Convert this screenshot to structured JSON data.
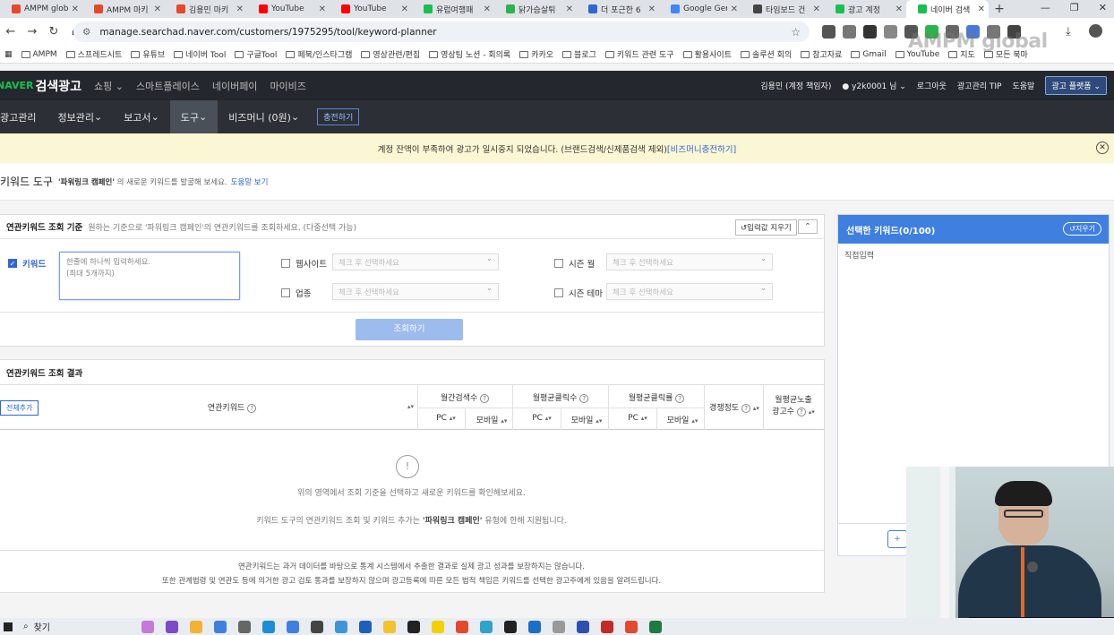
{
  "browser": {
    "tabs": [
      {
        "label": "AMPM glob",
        "color": "#e8472b"
      },
      {
        "label": "AMPM 마키",
        "color": "#e8472b"
      },
      {
        "label": "김용민 마키",
        "color": "#e8472b"
      },
      {
        "label": "YouTube",
        "color": "#ff0000"
      },
      {
        "label": "YouTube",
        "color": "#ff0000"
      },
      {
        "label": "유럽여행패",
        "color": "#17c04f"
      },
      {
        "label": "닭가슴살튀",
        "color": "#2ab54a"
      },
      {
        "label": "더 포근한 6",
        "color": "#2e67d1"
      },
      {
        "label": "Google Gen",
        "color": "#4285f4"
      },
      {
        "label": "타임보드 건",
        "color": "#444444"
      },
      {
        "label": "광고 계정",
        "color": "#17c04f"
      },
      {
        "label": "네이버 검색",
        "color": "#17c04f"
      }
    ],
    "active_tab_index": 11,
    "url": "manage.searchad.naver.com/customers/1975295/tool/keyword-planner",
    "bookmarks": [
      "AMPM",
      "스프레드시트",
      "유튜브",
      "네이버 Tool",
      "구글Tool",
      "페북/인스타그램",
      "영상관련/편집",
      "영상팀 노션 - 회의록",
      "카카오",
      "블로그",
      "키워드 관련 도구",
      "활용사이트",
      "솔루션 회의",
      "참고자료",
      "Gmail",
      "YouTube",
      "지도",
      "모든 북마"
    ]
  },
  "watermark": "AMPM global",
  "naver_header": {
    "logo": "NAVER",
    "service": "검색광고",
    "nav": [
      "쇼핑",
      "스마트플레이스",
      "네이버페이",
      "마이비즈"
    ],
    "user": "김용민 (계정 책임자)",
    "account": "y2k0001 님",
    "logout": "로그아웃",
    "tip": "광고관리 TIP",
    "help": "도움말",
    "platform_btn": "광고 플랫폼"
  },
  "menubar": {
    "items": [
      "광고관리",
      "정보관리",
      "보고서",
      "도구",
      "비즈머니 (0원)"
    ],
    "active_index": 3,
    "charge_btn": "충전하기"
  },
  "alert": {
    "text": "계정 잔액이 부족하여 광고가 일시중지 되었습니다. (브랜드검색/신제품검색 제외)",
    "link": "[비즈머니충전하기]"
  },
  "page": {
    "title": "키워드 도구",
    "desc_campaign": "'파워링크 캠페인'",
    "desc_rest": "의 새로운 키워드를 발굴해 보세요.",
    "help_link": "도움말 보기"
  },
  "search": {
    "title": "연관키워드 조회 기준",
    "subtitle": "원하는 기준으로 '파워링크 캠페인'의 연관키워드를 조회하세요. (다중선택 가능)",
    "reset_btn": "입력값 지우기",
    "keyword_label": "키워드",
    "keyword_placeholder_1": "한줄에 하나씩 입력하세요.",
    "keyword_placeholder_2": "(최대 5개까지)",
    "website_label": "웹사이트",
    "industry_label": "업종",
    "season_month_label": "시즌 월",
    "season_theme_label": "시즌 테마",
    "select_placeholder": "체크 후 선택하세요",
    "submit": "조회하기"
  },
  "results": {
    "title": "연관키워드 조회 결과",
    "add_all": "전체추가",
    "columns": {
      "keyword": "연관키워드",
      "monthly_search": "월간검색수",
      "avg_clicks": "월평균클릭수",
      "avg_ctr": "월평균클릭률",
      "competition": "경쟁정도",
      "avg_ads_1": "월평균노출",
      "avg_ads_2": "광고수",
      "pc": "PC",
      "mobile": "모바일"
    },
    "empty_msg": "위의 영역에서 조회 기준을 선택하고 새로운 키워드를 확인해보세요.",
    "empty_note_pre": "키워드 도구의 연관키워드 조회 및 키워드 추가는",
    "empty_note_bold": "'파워링크 캠페인'",
    "empty_note_post": "유형에 한해 지원됩니다.",
    "note1": "연관키워드는 과거 데이터를 바탕으로 통계 시스템에서 추출한 결과로 실제 광고 성과를 보장하지는 않습니다.",
    "note2": "또한 관계법령 및 연관도 등에 의거한 광고 검토 통과를 보장하지 않으며 광고등록에 따른 모든 법적 책임은 키워드를 선택한 광고주에게 있음을 알려드립니다."
  },
  "selected": {
    "title": "선택한 키워드(0/100)",
    "clear_btn": "지우기",
    "direct_input": "직접입력"
  },
  "taskbar": {
    "search": "찾기"
  }
}
